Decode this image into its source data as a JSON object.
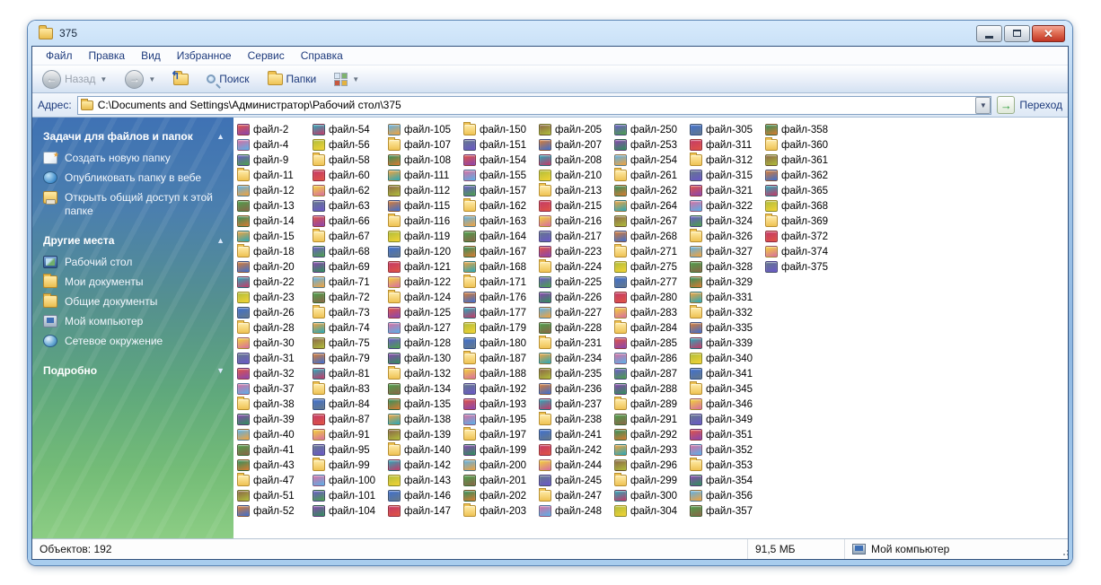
{
  "window": {
    "title": "375"
  },
  "menu": {
    "items": [
      "Файл",
      "Правка",
      "Вид",
      "Избранное",
      "Сервис",
      "Справка"
    ]
  },
  "toolbar": {
    "back_label": "Назад",
    "search_label": "Поиск",
    "folders_label": "Папки"
  },
  "addressbar": {
    "label": "Адрес:",
    "value": "C:\\Documents and Settings\\Администратор\\Рабочий стол\\375",
    "go_label": "Переход"
  },
  "sidebar": {
    "sections": [
      {
        "title": "Задачи для файлов и папок",
        "collapsed": false,
        "items": [
          {
            "label": "Создать новую папку",
            "icon": "new-folder-icon",
            "icon_class": "sbi-newfolder"
          },
          {
            "label": "Опубликовать папку в вебе",
            "icon": "publish-web-icon",
            "icon_class": "sbi-web"
          },
          {
            "label": "Открыть общий доступ к этой папке",
            "icon": "share-folder-icon",
            "icon_class": "sbi-share"
          }
        ]
      },
      {
        "title": "Другие места",
        "collapsed": false,
        "items": [
          {
            "label": "Рабочий стол",
            "icon": "desktop-icon",
            "icon_class": "sbi-desktop"
          },
          {
            "label": "Мои документы",
            "icon": "my-documents-icon",
            "icon_class": "sbi-folder"
          },
          {
            "label": "Общие документы",
            "icon": "shared-documents-icon",
            "icon_class": "sbi-folder"
          },
          {
            "label": "Мой компьютер",
            "icon": "my-computer-icon",
            "icon_class": "sbi-computer"
          },
          {
            "label": "Сетевое окружение",
            "icon": "network-places-icon",
            "icon_class": "sbi-network"
          }
        ]
      },
      {
        "title": "Подробно",
        "collapsed": true,
        "items": []
      }
    ]
  },
  "files": {
    "rows_per_column": 26,
    "names": [
      "файл-2",
      "файл-4",
      "файл-9",
      "файл-11",
      "файл-12",
      "файл-13",
      "файл-14",
      "файл-15",
      "файл-18",
      "файл-20",
      "файл-22",
      "файл-23",
      "файл-26",
      "файл-28",
      "файл-30",
      "файл-31",
      "файл-32",
      "файл-37",
      "файл-38",
      "файл-39",
      "файл-40",
      "файл-41",
      "файл-43",
      "файл-47",
      "файл-51",
      "файл-52",
      "файл-54",
      "файл-56",
      "файл-58",
      "файл-60",
      "файл-62",
      "файл-63",
      "файл-66",
      "файл-67",
      "файл-68",
      "файл-69",
      "файл-71",
      "файл-72",
      "файл-73",
      "файл-74",
      "файл-75",
      "файл-79",
      "файл-81",
      "файл-83",
      "файл-84",
      "файл-87",
      "файл-91",
      "файл-95",
      "файл-99",
      "файл-100",
      "файл-101",
      "файл-104",
      "файл-105",
      "файл-107",
      "файл-108",
      "файл-111",
      "файл-112",
      "файл-115",
      "файл-116",
      "файл-119",
      "файл-120",
      "файл-121",
      "файл-122",
      "файл-124",
      "файл-125",
      "файл-127",
      "файл-128",
      "файл-130",
      "файл-132",
      "файл-134",
      "файл-135",
      "файл-138",
      "файл-139",
      "файл-140",
      "файл-142",
      "файл-143",
      "файл-146",
      "файл-147",
      "файл-150",
      "файл-151",
      "файл-154",
      "файл-155",
      "файл-157",
      "файл-162",
      "файл-163",
      "файл-164",
      "файл-167",
      "файл-168",
      "файл-171",
      "файл-176",
      "файл-177",
      "файл-179",
      "файл-180",
      "файл-187",
      "файл-188",
      "файл-192",
      "файл-193",
      "файл-195",
      "файл-197",
      "файл-199",
      "файл-200",
      "файл-201",
      "файл-202",
      "файл-203",
      "файл-205",
      "файл-207",
      "файл-208",
      "файл-210",
      "файл-213",
      "файл-215",
      "файл-216",
      "файл-217",
      "файл-223",
      "файл-224",
      "файл-225",
      "файл-226",
      "файл-227",
      "файл-228",
      "файл-231",
      "файл-234",
      "файл-235",
      "файл-236",
      "файл-237",
      "файл-238",
      "файл-241",
      "файл-242",
      "файл-244",
      "файл-245",
      "файл-247",
      "файл-248",
      "файл-250",
      "файл-253",
      "файл-254",
      "файл-261",
      "файл-262",
      "файл-264",
      "файл-267",
      "файл-268",
      "файл-271",
      "файл-275",
      "файл-277",
      "файл-280",
      "файл-283",
      "файл-284",
      "файл-285",
      "файл-286",
      "файл-287",
      "файл-288",
      "файл-289",
      "файл-291",
      "файл-292",
      "файл-293",
      "файл-296",
      "файл-299",
      "файл-300",
      "файл-304",
      "файл-305",
      "файл-311",
      "файл-312",
      "файл-315",
      "файл-321",
      "файл-322",
      "файл-324",
      "файл-326",
      "файл-327",
      "файл-328",
      "файл-329",
      "файл-331",
      "файл-332",
      "файл-335",
      "файл-339",
      "файл-340",
      "файл-341",
      "файл-345",
      "файл-346",
      "файл-349",
      "файл-351",
      "файл-352",
      "файл-353",
      "файл-354",
      "файл-356",
      "файл-357",
      "файл-358",
      "файл-360",
      "файл-361",
      "файл-362",
      "файл-365",
      "файл-368",
      "файл-369",
      "файл-372",
      "файл-374",
      "файл-375"
    ]
  },
  "statusbar": {
    "objects": "Объектов: 192",
    "size": "91,5 МБ",
    "zone": "Мой компьютер"
  },
  "colors": {
    "frame_blue": "#8fb8e2",
    "sidebar_top": "#3f72b4",
    "sidebar_bottom": "#8ccd84",
    "menu_text": "#1d3a7c",
    "icon_palette": [
      "#e05344",
      "#f2a33c",
      "#f3d335",
      "#4ba04b",
      "#3e6fd0",
      "#8a46b0",
      "#29a8b8",
      "#d86ea0",
      "#8a6547",
      "#64788a",
      "#2f8f5b",
      "#c43a68",
      "#5ab0e8",
      "#b0bd3a",
      "#6a58c9",
      "#d97b31"
    ]
  }
}
